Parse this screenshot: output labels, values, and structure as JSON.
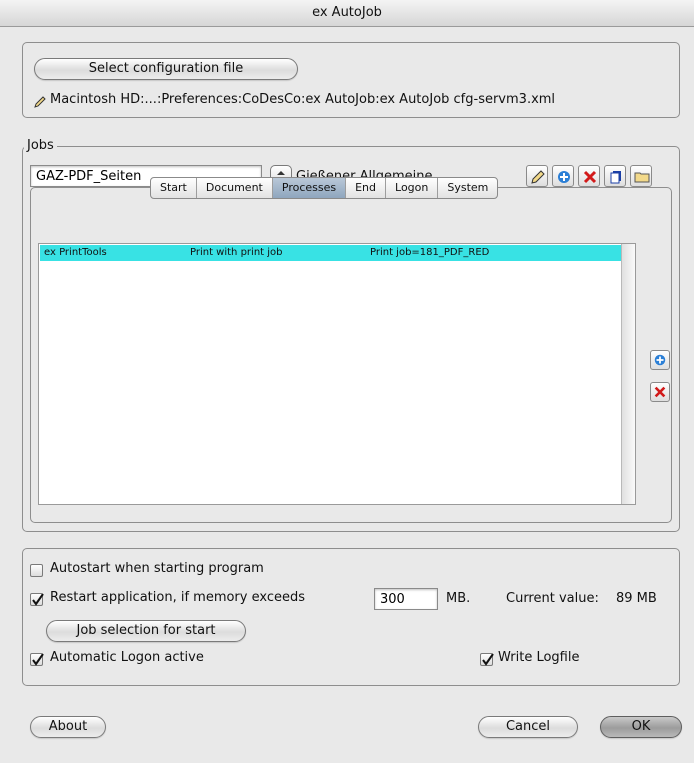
{
  "window": {
    "title": "ex AutoJob"
  },
  "config": {
    "select_button": "Select configuration file",
    "path": "Macintosh HD:...:Preferences:CoDesCo:ex AutoJob:ex AutoJob cfg-servm3.xml"
  },
  "jobs": {
    "legend": "Jobs",
    "job_name": "GAZ-PDF_Seiten",
    "job_group": "Gießener Allgemeine",
    "toolbar_icons": [
      "pencil-icon",
      "plus-icon",
      "delete-icon",
      "copy-icon",
      "folder-icon"
    ],
    "tabs": [
      "Start",
      "Document",
      "Processes",
      "End",
      "Logon",
      "System"
    ],
    "active_tab": "Processes",
    "processes": [
      {
        "module": "ex PrintTools",
        "action": "Print with print job",
        "param": "Print job=181_PDF_RED"
      }
    ]
  },
  "options": {
    "autostart_label": "Autostart when starting program",
    "autostart_checked": false,
    "restart_label": "Restart application, if memory exceeds",
    "restart_checked": true,
    "memory_value": "300",
    "memory_unit": "MB.",
    "current_label": "Current value:",
    "current_value": "89 MB",
    "job_selection_button": "Job selection for start",
    "auto_logon_label": "Automatic Logon active",
    "auto_logon_checked": true,
    "logfile_label": "Write Logfile",
    "logfile_checked": true
  },
  "footer": {
    "about": "About",
    "cancel": "Cancel",
    "ok": "OK"
  }
}
